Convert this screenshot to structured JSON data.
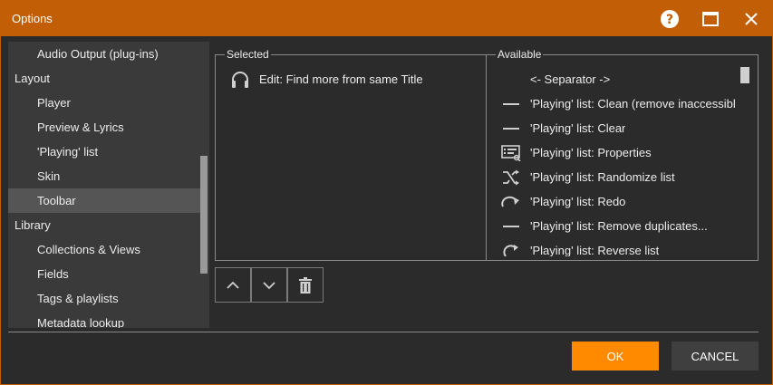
{
  "window": {
    "title": "Options"
  },
  "sidebar": {
    "items": [
      {
        "label": "Audio Output (plug-ins)",
        "level": "child"
      },
      {
        "label": "Layout",
        "level": "parent"
      },
      {
        "label": "Player",
        "level": "child"
      },
      {
        "label": "Preview & Lyrics",
        "level": "child"
      },
      {
        "label": "'Playing' list",
        "level": "child"
      },
      {
        "label": "Skin",
        "level": "child"
      },
      {
        "label": "Toolbar",
        "level": "child",
        "selected": true
      },
      {
        "label": "Library",
        "level": "parent"
      },
      {
        "label": "Collections & Views",
        "level": "child"
      },
      {
        "label": "Fields",
        "level": "child"
      },
      {
        "label": "Tags & playlists",
        "level": "child"
      },
      {
        "label": "Metadata lookup",
        "level": "child"
      }
    ]
  },
  "selected": {
    "label": "Selected",
    "items": [
      {
        "icon": "headphones-icon",
        "label": "Edit: Find more from same Title"
      }
    ]
  },
  "available": {
    "label": "Available",
    "items": [
      {
        "icon": "none",
        "label": "<- Separator ->"
      },
      {
        "icon": "dash-icon",
        "label": "'Playing' list: Clean (remove inaccessibl"
      },
      {
        "icon": "dash-icon",
        "label": "'Playing' list: Clear"
      },
      {
        "icon": "properties-icon",
        "label": "'Playing' list: Properties"
      },
      {
        "icon": "shuffle-icon",
        "label": "'Playing' list: Randomize list"
      },
      {
        "icon": "redo-icon",
        "label": "'Playing' list: Redo"
      },
      {
        "icon": "dash-icon",
        "label": "'Playing' list: Remove duplicates..."
      },
      {
        "icon": "reverse-icon",
        "label": "'Playing' list: Reverse list"
      }
    ]
  },
  "buttons": {
    "ok": "OK",
    "cancel": "CANCEL"
  },
  "colors": {
    "titlebar": "#c25e05",
    "accent": "#ff8a00",
    "background": "#2b2b2b"
  }
}
